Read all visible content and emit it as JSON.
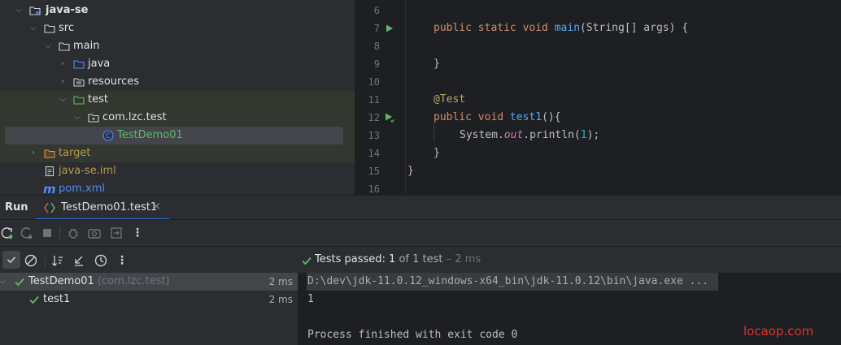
{
  "project_tree": {
    "items": [
      {
        "label": "java-se",
        "icon": "module-folder-icon"
      },
      {
        "label": "src",
        "icon": "folder-icon"
      },
      {
        "label": "main",
        "icon": "folder-icon"
      },
      {
        "label": "java",
        "icon": "source-folder-icon"
      },
      {
        "label": "resources",
        "icon": "resources-folder-icon"
      },
      {
        "label": "test",
        "icon": "test-folder-icon"
      },
      {
        "label": "com.lzc.test",
        "icon": "package-icon"
      },
      {
        "label": "TestDemo01",
        "icon": "class-icon"
      },
      {
        "label": "target",
        "icon": "excluded-folder-icon"
      },
      {
        "label": "java-se.iml",
        "icon": "iml-file-icon"
      },
      {
        "label": "pom.xml",
        "icon": "maven-icon"
      }
    ]
  },
  "editor": {
    "line_numbers": [
      "6",
      "7",
      "8",
      "9",
      "10",
      "11",
      "12",
      "13",
      "14",
      "15",
      "16"
    ],
    "code": {
      "l7_kw": "public static void ",
      "l7_fn": "main",
      "l7_rest": "(String[] args) {",
      "l9": "}",
      "l11": "@Test",
      "l12_kw": "public void ",
      "l12_fn": "test1",
      "l12_rest": "(){",
      "l13_cls": "System.",
      "l13_field": "out",
      "l13_call": ".println(",
      "l13_num": "1",
      "l13_end": ");",
      "l14": "}",
      "l15": "}"
    }
  },
  "run_panel": {
    "title": "Run",
    "tab_label": "TestDemo01.test1",
    "status": {
      "passed_label": "Tests passed:",
      "passed_count": "1",
      "of_label": "of 1 test",
      "duration": "– 2 ms"
    },
    "results": [
      {
        "name": "TestDemo01",
        "package": "(com.lzc.test)",
        "time": "2 ms"
      },
      {
        "name": "test1",
        "package": "",
        "time": "2 ms"
      }
    ],
    "console": {
      "command": "D:\\dev\\jdk-11.0.12_windows-x64_bin\\jdk-11.0.12\\bin\\java.exe ...",
      "output": "1",
      "exit": "Process finished with exit code 0"
    }
  },
  "watermark": "locaop.com",
  "colors": {
    "accent": "#3574f0",
    "passed": "#5fb865",
    "watermark": "#e0312e"
  }
}
